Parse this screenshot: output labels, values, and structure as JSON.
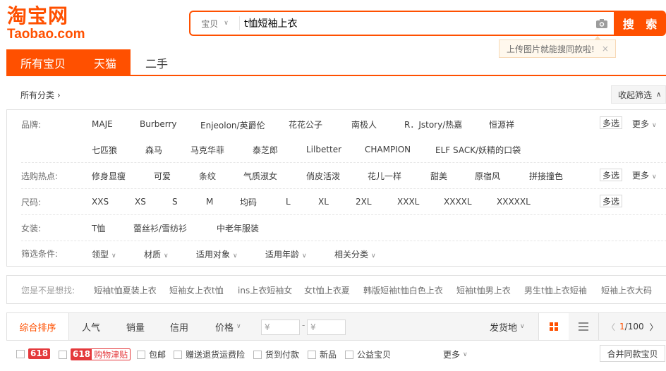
{
  "logo": {
    "cn": "淘宝网",
    "en": "Taobao.com"
  },
  "search": {
    "type_label": "宝贝",
    "query": "t恤短袖上衣",
    "button": "搜 索",
    "tooltip": "上传图片就能搜同款啦!",
    "tooltip_close": "×"
  },
  "tabs": [
    "所有宝贝",
    "天猫",
    "二手"
  ],
  "all_category": "所有分类",
  "collapse_label": "收起筛选",
  "filters": {
    "brand": {
      "label": "品牌:",
      "row1": [
        "MAJE",
        "Burberry",
        "Enjeolon/英爵伦",
        "花花公子",
        "南极人",
        "R．Jstory/热嘉",
        "恒源祥"
      ],
      "row2": [
        "七匹狼",
        "森马",
        "马克华菲",
        "泰芝郎",
        "Lilbetter",
        "CHAMPION",
        "ELF SACK/妖精的口袋"
      ]
    },
    "hot": {
      "label": "选购热点:",
      "items": [
        "修身显瘦",
        "可爱",
        "条纹",
        "气质淑女",
        "俏皮活泼",
        "花儿一样",
        "甜美",
        "原宿风",
        "拼接撞色"
      ]
    },
    "size": {
      "label": "尺码:",
      "items": [
        "XXS",
        "XS",
        "S",
        "M",
        "均码",
        "L",
        "XL",
        "2XL",
        "XXXL",
        "XXXXL",
        "XXXXXL"
      ]
    },
    "women": {
      "label": "女装:",
      "items": [
        "T恤",
        "蕾丝衫/雪纺衫",
        "中老年服装"
      ]
    },
    "conditions": {
      "label": "筛选条件:",
      "items": [
        "领型",
        "材质",
        "适用对象",
        "适用年龄",
        "相关分类"
      ]
    },
    "multi_label": "多选",
    "more_label": "更多"
  },
  "suggest": {
    "label": "您是不是想找:",
    "items": [
      "短袖t恤夏装上衣",
      "短袖女上衣t恤",
      "ins上衣短袖女",
      "女t恤上衣夏",
      "韩版短袖t恤白色上衣",
      "短袖t恤男上衣",
      "男生t恤上衣短袖",
      "短袖上衣大码"
    ]
  },
  "sort": {
    "items": [
      "综合排序",
      "人气",
      "销量",
      "信用",
      "价格"
    ],
    "price_from": "¥",
    "price_to": "¥",
    "dash": "-",
    "ship_from": "发货地",
    "page_current": "1",
    "page_total": "/100"
  },
  "checks": {
    "badge_618": "618",
    "badge_sub_a": "618",
    "badge_sub_b": "购物津贴",
    "items": [
      "包邮",
      "赠送退货运费险",
      "货到付款",
      "新品",
      "公益宝贝"
    ],
    "more": "更多",
    "merge": "合并同款宝贝"
  },
  "colors": {
    "accent": "#ff5000",
    "badge": "#e4393c"
  }
}
